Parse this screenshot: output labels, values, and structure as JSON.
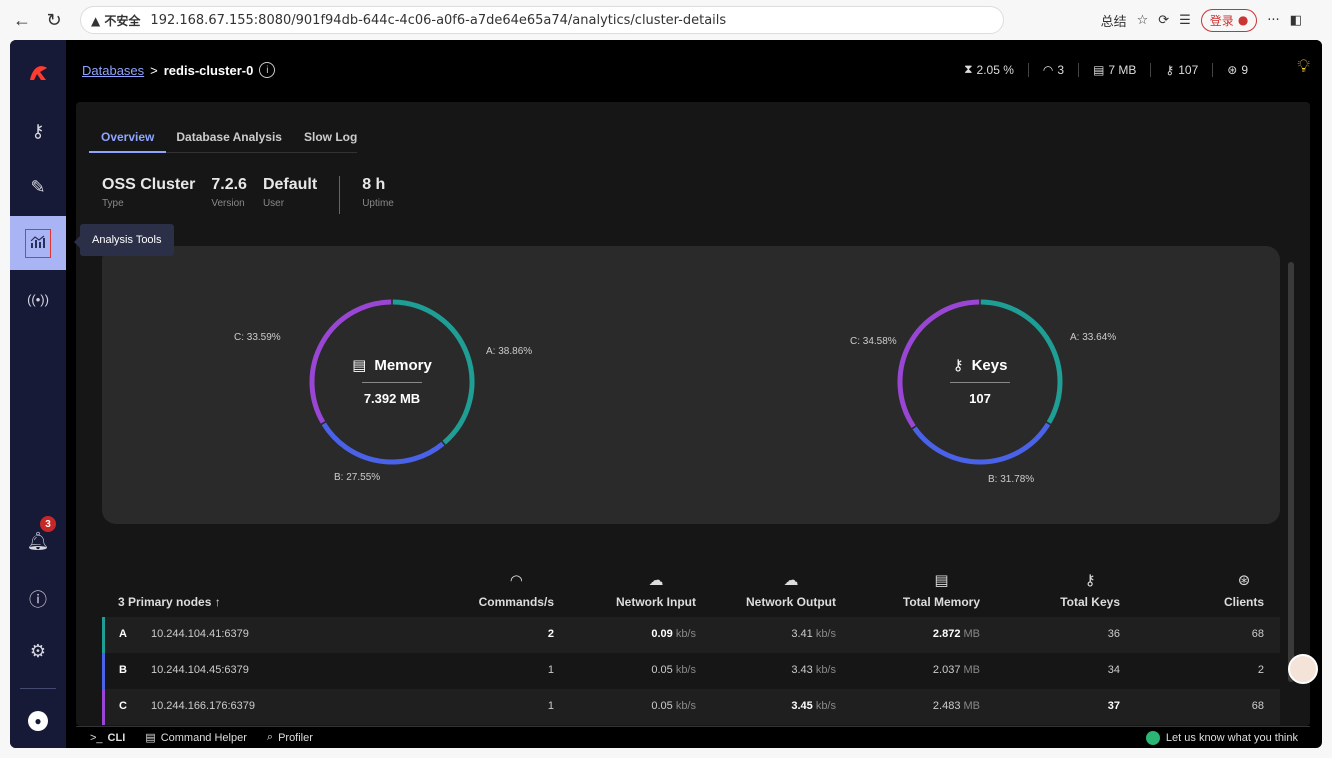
{
  "browser": {
    "warning": "▲ 不安全",
    "url": "192.168.67.155:8080/901f94db-644c-4c06-a0f6-a7de64e65a74/analytics/cluster-details",
    "summary_label": "总结",
    "login_label": "登录",
    "more": "···"
  },
  "sidebar": {
    "notification_count": "3",
    "tooltip": "Analysis Tools"
  },
  "breadcrumb": {
    "databases": "Databases",
    "separator": ">",
    "db_name": "redis-cluster-0"
  },
  "top_stats": [
    {
      "icon": "cpu-icon",
      "value": "2.05 %"
    },
    {
      "icon": "gauge-icon",
      "value": "3"
    },
    {
      "icon": "memory-icon",
      "value": "7 MB"
    },
    {
      "icon": "key-icon",
      "value": "107"
    },
    {
      "icon": "user-icon",
      "value": "9"
    }
  ],
  "tabs": [
    "Overview",
    "Database Analysis",
    "Slow Log"
  ],
  "db_info": [
    {
      "value": "OSS Cluster",
      "label": "Type"
    },
    {
      "value": "7.2.6",
      "label": "Version"
    },
    {
      "value": "Default",
      "label": "User"
    },
    {
      "value": "8 h",
      "label": "Uptime"
    }
  ],
  "colors": {
    "A": "#1f9e95",
    "B": "#4a62e8",
    "C": "#9a46d4",
    "accent": "#8ea4ff"
  },
  "chart_data": [
    {
      "type": "pie",
      "title": "Memory",
      "center_value": "7.392 MB",
      "categories": [
        "A",
        "B",
        "C"
      ],
      "values": [
        38.86,
        27.55,
        33.59
      ],
      "labels": [
        "A: 38.86%",
        "B: 27.55%",
        "C: 33.59%"
      ]
    },
    {
      "type": "pie",
      "title": "Keys",
      "center_value": "107",
      "categories": [
        "A",
        "B",
        "C"
      ],
      "values": [
        33.64,
        31.78,
        34.58
      ],
      "labels": [
        "A: 33.64%",
        "B: 31.78%",
        "C: 34.58%"
      ]
    }
  ],
  "table": {
    "title": "3 Primary nodes",
    "sort_indicator": "↑",
    "columns": [
      "Commands/s",
      "Network Input",
      "Network Output",
      "Total Memory",
      "Total Keys",
      "Clients"
    ],
    "rows": [
      {
        "letter": "A",
        "address": "10.244.104.41:6379",
        "commands": "2",
        "net_in": "0.09",
        "net_in_unit": "kb/s",
        "net_out": "3.41",
        "net_out_unit": "kb/s",
        "memory": "2.872",
        "memory_unit": "MB",
        "keys": "36",
        "clients": "68"
      },
      {
        "letter": "B",
        "address": "10.244.104.45:6379",
        "commands": "1",
        "net_in": "0.05",
        "net_in_unit": "kb/s",
        "net_out": "3.43",
        "net_out_unit": "kb/s",
        "memory": "2.037",
        "memory_unit": "MB",
        "keys": "34",
        "clients": "2"
      },
      {
        "letter": "C",
        "address": "10.244.166.176:6379",
        "commands": "1",
        "net_in": "0.05",
        "net_in_unit": "kb/s",
        "net_out": "3.45",
        "net_out_unit": "kb/s",
        "memory": "2.483",
        "memory_unit": "MB",
        "keys": "37",
        "clients": "68"
      }
    ]
  },
  "footer": {
    "cli": "CLI",
    "helper": "Command Helper",
    "profiler": "Profiler",
    "feedback": "Let us know what you think"
  }
}
